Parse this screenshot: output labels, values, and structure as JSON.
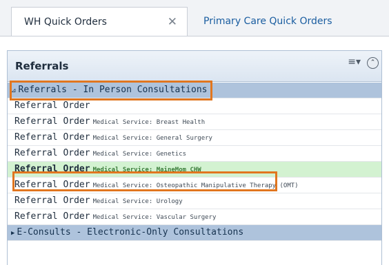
{
  "tabs": [
    {
      "label": "WH Quick Orders",
      "close_icon": "✕"
    },
    {
      "label": "Primary Care Quick Orders"
    }
  ],
  "panel": {
    "title": "Referrals",
    "menu_icon": "≡▾",
    "collapse_icon": "⌃"
  },
  "groups": [
    {
      "arrow": "⊿",
      "label": "Referrals - In Person Consultations",
      "expanded": true
    },
    {
      "arrow": "▶",
      "label": "E-Consults - Electronic-Only Consultations",
      "expanded": false
    }
  ],
  "orders": [
    {
      "name": "Referral Order",
      "service": ""
    },
    {
      "name": "Referral Order",
      "service": "Medical Service: Breast Health"
    },
    {
      "name": "Referral Order",
      "service": "Medical Service: General Surgery"
    },
    {
      "name": "Referral Order",
      "service": "Medical Service: Genetics"
    },
    {
      "name": "Referral Order",
      "service": "Medical Service: MaineMom CHW",
      "selected": true
    },
    {
      "name": "Referral Order",
      "service": "Medical Service: Osteopathic Manipulative Therapy (OMT)"
    },
    {
      "name": "Referral Order",
      "service": "Medical Service: Urology"
    },
    {
      "name": "Referral Order",
      "service": "Medical Service: Vascular Surgery"
    }
  ],
  "colors": {
    "highlight_box": "#e1761f",
    "selected_row": "#d3f2d1",
    "group_row": "#aec3dc"
  }
}
